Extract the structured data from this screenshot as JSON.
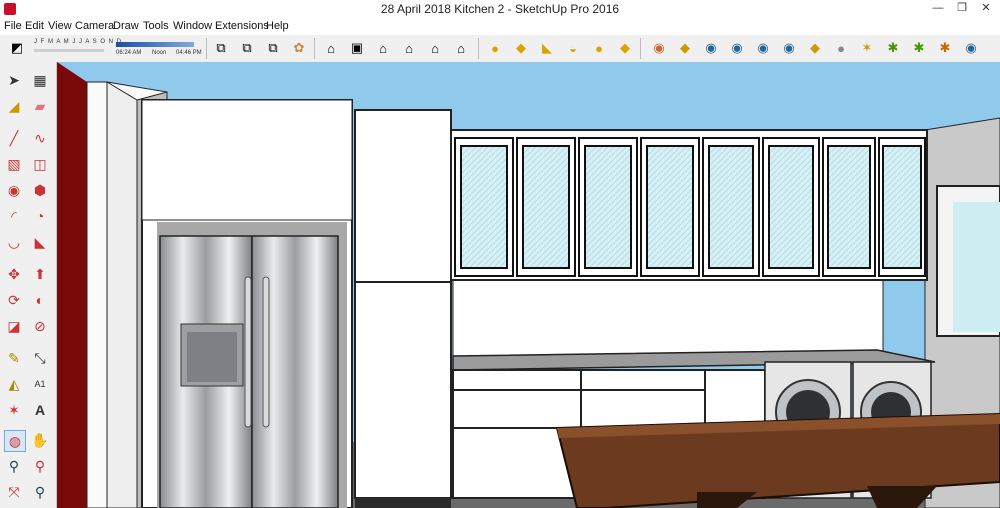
{
  "window": {
    "title": "28 April 2018 Kitchen 2 - SketchUp Pro 2016",
    "minimize": "—",
    "maximize": "❐",
    "close": "✕"
  },
  "menu": [
    "File",
    "Edit",
    "View",
    "Camera",
    "Draw",
    "Tools",
    "Window",
    "Extensions",
    "Help"
  ],
  "shadow_settings": {
    "months": "J F M A M J J A S O N D",
    "time_start": "06:24 AM",
    "time_noon": "Noon",
    "time_end": "04:46 PM"
  },
  "toolbar_icons": [
    "shadows-toggle-icon",
    "warehouse-icon",
    "extension-warehouse-icon",
    "share-model-icon",
    "components-icon",
    "iso-view-icon",
    "top-view-icon",
    "front-view-icon",
    "right-view-icon",
    "back-view-icon",
    "left-view-icon",
    "xray-icon",
    "backedges-icon",
    "wireframe-icon",
    "hiddenline-icon",
    "shaded-icon",
    "textured-icon",
    "ruby-plugin-icons"
  ],
  "tools": [
    "select-icon",
    "make-component-icon",
    "paint-bucket-icon",
    "eraser-icon",
    "line-icon",
    "freehand-icon",
    "rectangle-icon",
    "rotated-rectangle-icon",
    "circle-icon",
    "polygon-icon",
    "arc-icon",
    "pie-icon",
    "two-point-arc-icon",
    "three-point-arc-icon",
    "move-icon",
    "push-pull-icon",
    "rotate-icon",
    "follow-me-icon",
    "scale-icon",
    "offset-icon",
    "tape-measure-icon",
    "dimension-icon",
    "protractor-icon",
    "text-icon",
    "axes-icon",
    "3d-text-icon",
    "orbit-icon",
    "pan-icon",
    "zoom-icon",
    "zoom-window-icon",
    "zoom-extents-icon",
    "previous-view-icon"
  ],
  "colors": {
    "sky": "#8fc9eb",
    "wall_red": "#7a0a0a",
    "wood": "#6b3a1f",
    "glass": "#cfeef4"
  }
}
